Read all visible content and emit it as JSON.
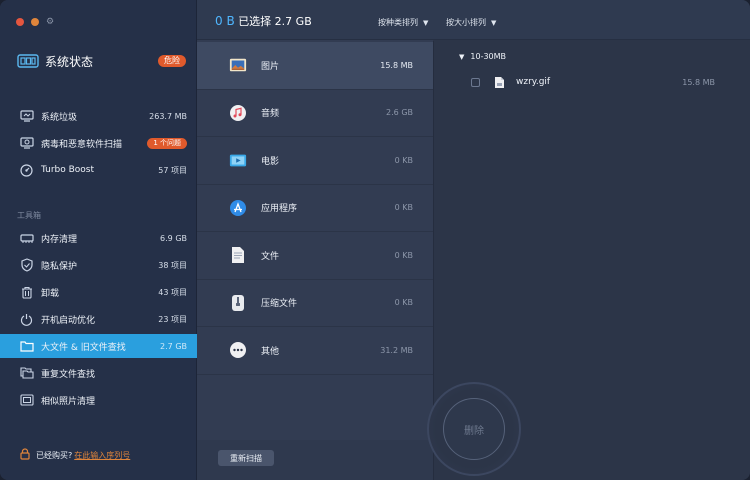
{
  "sidebar": {
    "status_label": "系统状态",
    "status_badge": "危险",
    "items_top": [
      {
        "label": "系统垃圾",
        "value": "263.7 MB"
      },
      {
        "label": "病毒和恶意软件扫描",
        "badge": "1 个问题"
      },
      {
        "label": "Turbo Boost",
        "value": "57 项目"
      }
    ],
    "toolbox_title": "工具箱",
    "tools": [
      {
        "label": "内存清理",
        "value": "6.9 GB"
      },
      {
        "label": "隐私保护",
        "value": "38 项目"
      },
      {
        "label": "卸载",
        "value": "43 项目"
      },
      {
        "label": "开机启动优化",
        "value": "23 项目"
      },
      {
        "label": "大文件 & 旧文件查找",
        "value": "2.7 GB"
      },
      {
        "label": "重复文件查找",
        "value": ""
      },
      {
        "label": "相似照片清理",
        "value": ""
      }
    ],
    "footer_text": "已经购买?",
    "footer_link": "在此输入序列号"
  },
  "header": {
    "selected_num": "0 B",
    "selected_text": "已选择 2.7 GB",
    "sort_type": "按种类排列",
    "sort_size": "按大小排列"
  },
  "categories": [
    {
      "name": "图片",
      "size": "15.8 MB"
    },
    {
      "name": "音频",
      "size": "2.6 GB"
    },
    {
      "name": "电影",
      "size": "0 KB"
    },
    {
      "name": "应用程序",
      "size": "0 KB"
    },
    {
      "name": "文件",
      "size": "0 KB"
    },
    {
      "name": "压缩文件",
      "size": "0 KB"
    },
    {
      "name": "其他",
      "size": "31.2 MB"
    }
  ],
  "actions": {
    "rescan": "重新扫描",
    "delete": "删除"
  },
  "files": {
    "group": "10-30MB",
    "items": [
      {
        "name": "wzry.gif",
        "size": "15.8 MB"
      }
    ]
  },
  "colors": {
    "accent": "#2a9fde",
    "danger": "#e05a2c",
    "highlight_num": "#4fb6ff"
  }
}
